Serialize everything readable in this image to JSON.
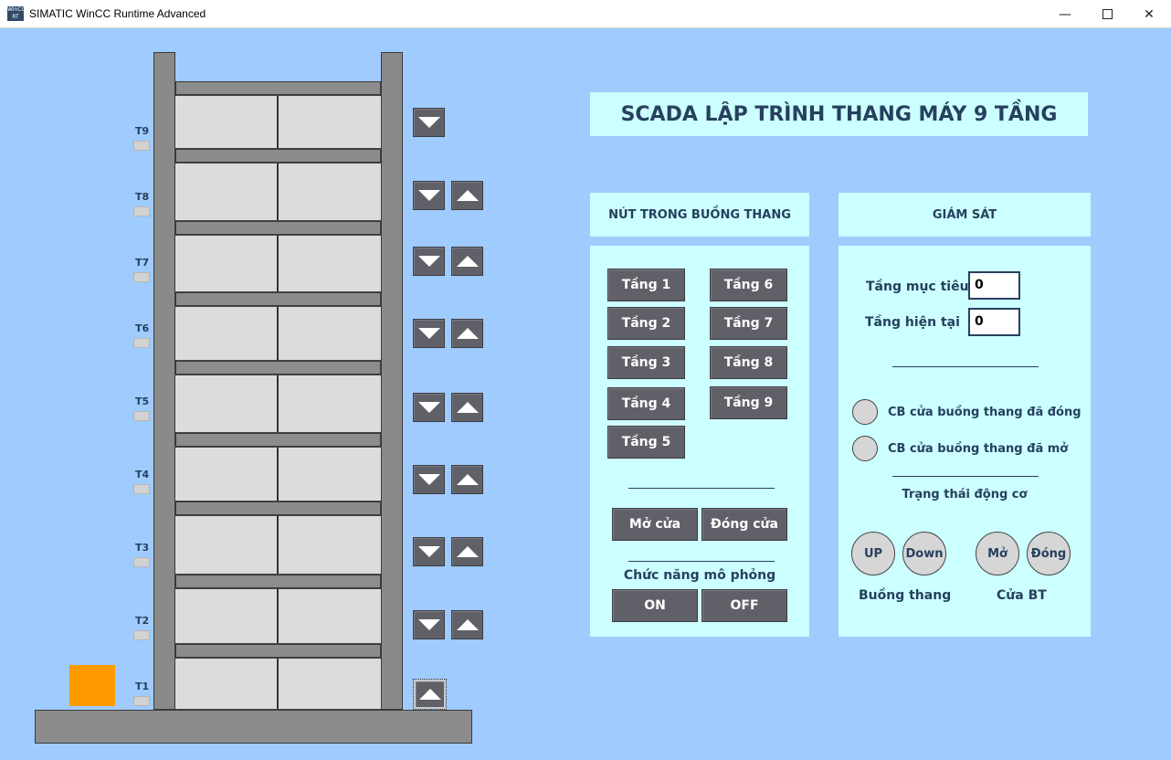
{
  "window": {
    "title": "SIMATIC WinCC Runtime Advanced",
    "icon_text": "WinCC RT",
    "minimize_icon": "minimize-icon",
    "maximize_icon": "maximize-icon",
    "close_icon": "close-icon"
  },
  "colors": {
    "background": "#9fcbff",
    "panel": "#ccffff",
    "button": "#606068",
    "text": "#26405e",
    "elevator_car": "#ff9a00",
    "structure": "#8c8c8c"
  },
  "building": {
    "floors": [
      {
        "label": "T9",
        "buttons": [
          "down"
        ]
      },
      {
        "label": "T8",
        "buttons": [
          "down",
          "up"
        ]
      },
      {
        "label": "T7",
        "buttons": [
          "down",
          "up"
        ]
      },
      {
        "label": "T6",
        "buttons": [
          "down",
          "up"
        ]
      },
      {
        "label": "T5",
        "buttons": [
          "down",
          "up"
        ]
      },
      {
        "label": "T4",
        "buttons": [
          "down",
          "up"
        ]
      },
      {
        "label": "T3",
        "buttons": [
          "down",
          "up"
        ]
      },
      {
        "label": "T2",
        "buttons": [
          "down",
          "up"
        ]
      },
      {
        "label": "T1",
        "buttons": [
          "up"
        ]
      }
    ],
    "car_floor": "T1"
  },
  "title": "SCADA LẬP TRÌNH THANG MÁY 9 TẦNG",
  "cabin_panel": {
    "header": "NÚT TRONG BUỒNG THANG",
    "floor_buttons": [
      "Tầng 1",
      "Tầng 2",
      "Tầng 3",
      "Tầng 4",
      "Tầng 5",
      "Tầng 6",
      "Tầng 7",
      "Tầng 8",
      "Tầng 9"
    ],
    "open_door": "Mở cửa",
    "close_door": "Đóng cửa",
    "sim_label": "Chức năng mô phỏng",
    "sim_on": "ON",
    "sim_off": "OFF"
  },
  "monitor_panel": {
    "header": "GIÁM SÁT",
    "target_floor_label": "Tầng mục tiêu",
    "target_floor_value": "0",
    "current_floor_label": "Tầng hiện tại",
    "current_floor_value": "0",
    "sensor_closed": "CB cửa buồng thang đã đóng",
    "sensor_open": "CB cửa buồng thang đã mở",
    "motor_status": "Trạng thái động cơ",
    "up": "UP",
    "down": "Down",
    "open": "Mở",
    "close": "Đóng",
    "cabin_label": "Buồng thang",
    "door_label": "Cửa BT"
  }
}
